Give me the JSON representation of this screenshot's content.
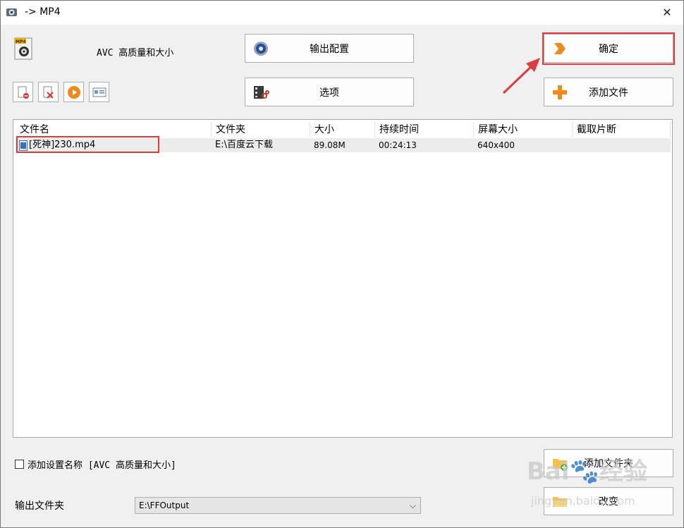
{
  "window": {
    "title": "-> MP4",
    "close_glyph": "✕"
  },
  "profile": {
    "icon": "mp4-format-icon",
    "label": "AVC 高质量和大小"
  },
  "buttons": {
    "output_config": "输出配置",
    "options": "选项",
    "ok": "确定",
    "add_file": "添加文件",
    "add_folder": "添加文件夹",
    "change": "改变"
  },
  "toolbar": [
    "remove-file-icon",
    "clear-list-icon",
    "play-icon",
    "media-info-icon"
  ],
  "file_list": {
    "columns": [
      "文件名",
      "文件夹",
      "大小",
      "持续时间",
      "屏幕大小",
      "截取片断"
    ],
    "rows": [
      {
        "name": "[死神]230.mp4",
        "folder": "E:\\百度云下载",
        "size": "89.08M",
        "duration": "00:24:13",
        "screen": "640x400",
        "clip": ""
      }
    ]
  },
  "add_setting_name": {
    "checked": false,
    "label": "添加设置名称 [AVC 高质量和大小]"
  },
  "output_folder": {
    "label": "输出文件夹",
    "value": "E:\\FFOutput"
  },
  "watermark": {
    "text": "Bai🐾经验",
    "sub": "jingyan.baidu.com"
  },
  "colors": {
    "highlight": "#e03a3a",
    "accent_orange": "#f08a1c"
  }
}
